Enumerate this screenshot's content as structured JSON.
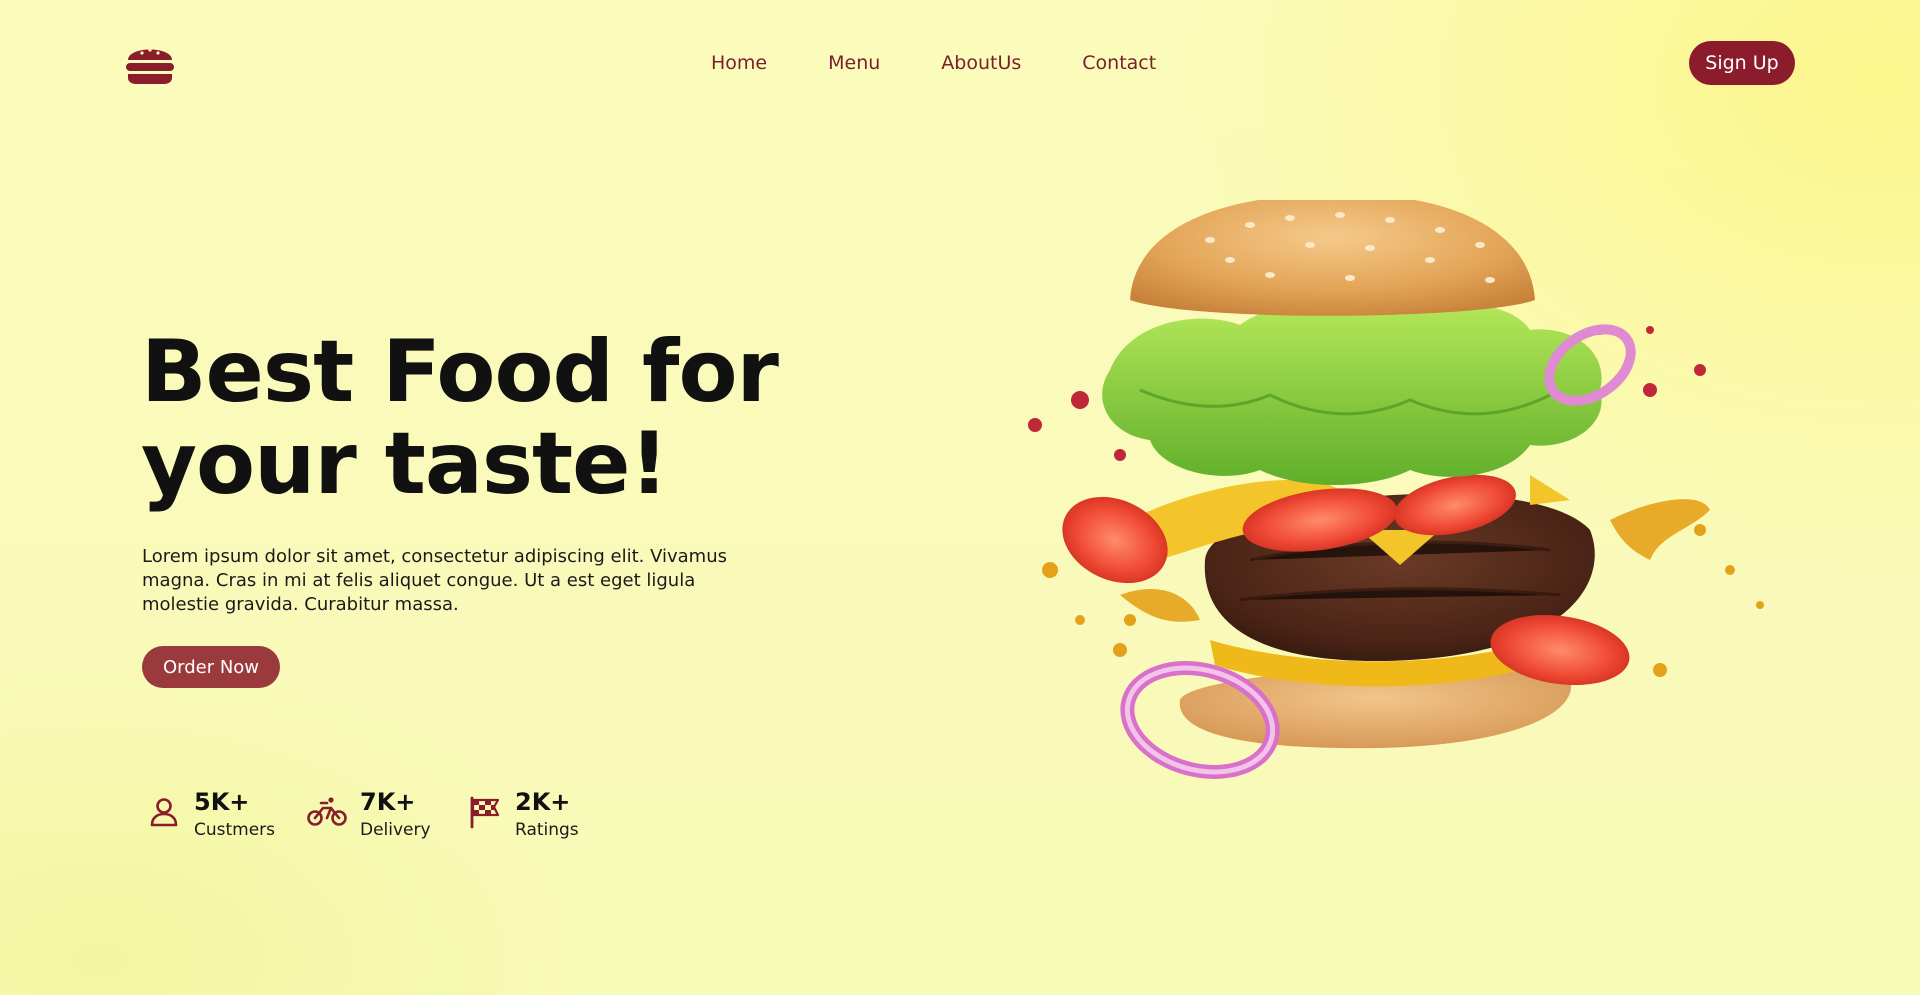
{
  "header": {
    "logo_icon": "burger-icon",
    "nav": [
      {
        "label": "Home"
      },
      {
        "label": "Menu"
      },
      {
        "label": "AboutUs"
      },
      {
        "label": "Contact"
      }
    ],
    "signup_label": "Sign Up"
  },
  "hero": {
    "title_line1": "Best Food for",
    "title_line2": "your taste!",
    "description": "Lorem ipsum dolor sit amet, consectetur adipiscing elit. Vivamus magna. Cras in mi at felis aliquet congue. Ut a est eget ligula molestie gravida. Curabitur massa.",
    "order_label": "Order Now",
    "image": "flying-burger-image"
  },
  "stats": [
    {
      "icon": "user-icon",
      "value": "5K+",
      "label": "Custmers"
    },
    {
      "icon": "motorbike-icon",
      "value": "7K+",
      "label": "Delivery"
    },
    {
      "icon": "checkered-flag-icon",
      "value": "2K+",
      "label": "Ratings"
    }
  ],
  "colors": {
    "accent": "#8b1c2c",
    "order_button": "#9a3a3c",
    "background": "#fbfbbb"
  }
}
